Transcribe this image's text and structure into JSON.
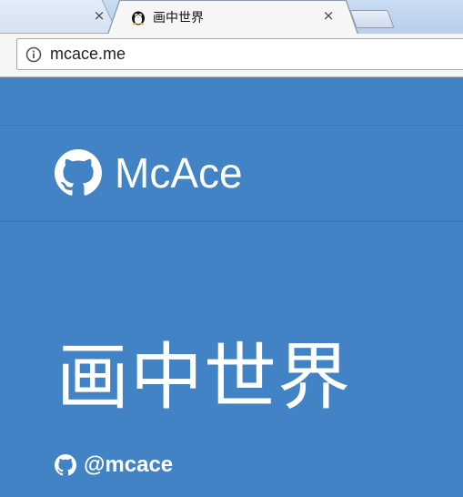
{
  "browser": {
    "inactive_tab_close": "×",
    "active_tab": {
      "title": "画中世界",
      "close": "×",
      "favicon": "penguin-favicon-icon"
    },
    "address_bar": {
      "url": "mcace.me",
      "security_icon": "info-icon"
    }
  },
  "page": {
    "background_color": "#4183c4",
    "header": {
      "brand_name": "McAce",
      "brand_icon": "github-icon"
    },
    "hero": {
      "title": "画中世界"
    },
    "profile": {
      "handle": "@mcace",
      "handle_icon": "github-icon"
    }
  }
}
